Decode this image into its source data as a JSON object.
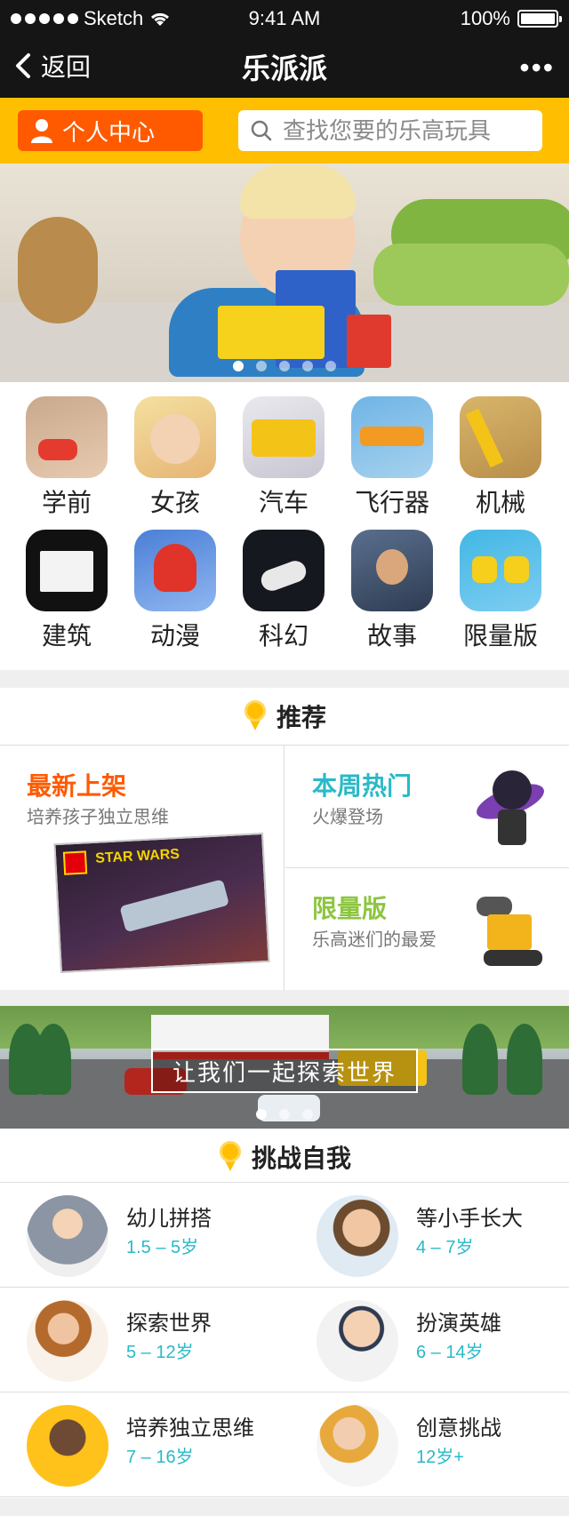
{
  "status_bar": {
    "carrier": "Sketch",
    "time": "9:41 AM",
    "battery": "100%"
  },
  "nav": {
    "back_label": "返回",
    "title": "乐派派",
    "more_label": "•••"
  },
  "toolbar": {
    "profile_label": "个人中心",
    "search_placeholder": "查找您要的乐高玩具"
  },
  "banner": {
    "page_count": 5,
    "active_index": 0
  },
  "categories": [
    {
      "label": "学前",
      "icon": "preschool-icon"
    },
    {
      "label": "女孩",
      "icon": "girls-icon"
    },
    {
      "label": "汽车",
      "icon": "cars-icon"
    },
    {
      "label": "飞行器",
      "icon": "aircraft-icon"
    },
    {
      "label": "机械",
      "icon": "machinery-icon"
    },
    {
      "label": "建筑",
      "icon": "architecture-icon"
    },
    {
      "label": "动漫",
      "icon": "anime-icon"
    },
    {
      "label": "科幻",
      "icon": "scifi-icon"
    },
    {
      "label": "故事",
      "icon": "story-icon"
    },
    {
      "label": "限量版",
      "icon": "limited-edition-icon"
    }
  ],
  "recommend": {
    "title": "推荐",
    "new_arrivals": {
      "title": "最新上架",
      "subtitle": "培养孩子独立思维",
      "title_color": "#ff5a00",
      "box_brand": "STAR WARS"
    },
    "weekly_hot": {
      "title": "本周热门",
      "subtitle": "火爆登场",
      "title_color": "#2ab9c7"
    },
    "limited": {
      "title": "限量版",
      "subtitle": "乐高迷们的最爱",
      "title_color": "#8cc63f"
    }
  },
  "banner2": {
    "cta_label": "让我们一起探索世界",
    "page_count": 3,
    "active_index": 0
  },
  "challenge": {
    "title": "挑战自我",
    "items": [
      {
        "name": "幼儿拼搭",
        "age": "1.5 – 5岁"
      },
      {
        "name": "等小手长大",
        "age": "4 – 7岁"
      },
      {
        "name": "探索世界",
        "age": "5 – 12岁"
      },
      {
        "name": "扮演英雄",
        "age": "6 – 14岁"
      },
      {
        "name": "培养独立思维",
        "age": "7 – 16岁"
      },
      {
        "name": "创意挑战",
        "age": "12岁+"
      }
    ]
  },
  "colors": {
    "brand_yellow": "#ffbf00",
    "accent_orange": "#ff5a00",
    "accent_teal": "#2ab9c7",
    "accent_green": "#8cc63f",
    "nav_background": "#151515"
  }
}
